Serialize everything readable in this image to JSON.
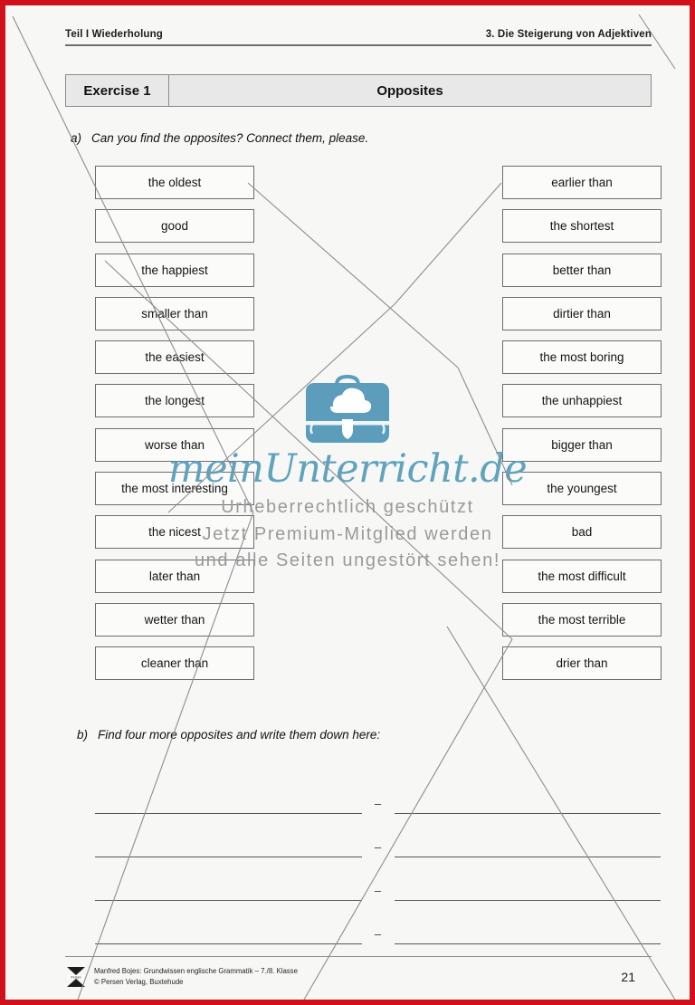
{
  "header": {
    "left": "Teil I  Wiederholung",
    "right": "3. Die Steigerung von Adjektiven"
  },
  "exercise": {
    "number_label": "Exercise 1",
    "title": "Opposites"
  },
  "tasks": {
    "a": {
      "letter": "a)",
      "text": "Can you find the opposites? Connect them, please."
    },
    "b": {
      "letter": "b)",
      "text": "Find four more opposites and write them down here:"
    }
  },
  "matching": {
    "left_column": [
      "the oldest",
      "good",
      "the happiest",
      "smaller than",
      "the easiest",
      "the longest",
      "worse than",
      "the most interesting",
      "the nicest",
      "later than",
      "wetter than",
      "cleaner than"
    ],
    "right_column": [
      "earlier than",
      "the shortest",
      "better than",
      "dirtier than",
      "the most boring",
      "the unhappiest",
      "bigger than",
      "the youngest",
      "bad",
      "the most difficult",
      "the most terrible",
      "drier than"
    ]
  },
  "answer_section": {
    "row_count": 4,
    "separator": "–"
  },
  "watermark": {
    "brand": "meinUnterricht.de",
    "line1": "Urheberrechtlich geschützt",
    "line2": "Jetzt Premium-Mitglied werden",
    "line3": "und alle Seiten ungestört sehen!",
    "brand_color": "#5fa3bd",
    "text_color": "#9a9a9a",
    "logo_icon": "school-bag-cloud-icon"
  },
  "footer": {
    "logo_icon": "persen-publisher-logo",
    "line1": "Manfred Bojes: Grundwissen englische Grammatik – 7./8. Klasse",
    "line2": "© Persen Verlag, Buxtehude",
    "page_number": "21"
  },
  "page": {
    "border_color": "#d0111b",
    "background_color": "#f7f7f6"
  }
}
